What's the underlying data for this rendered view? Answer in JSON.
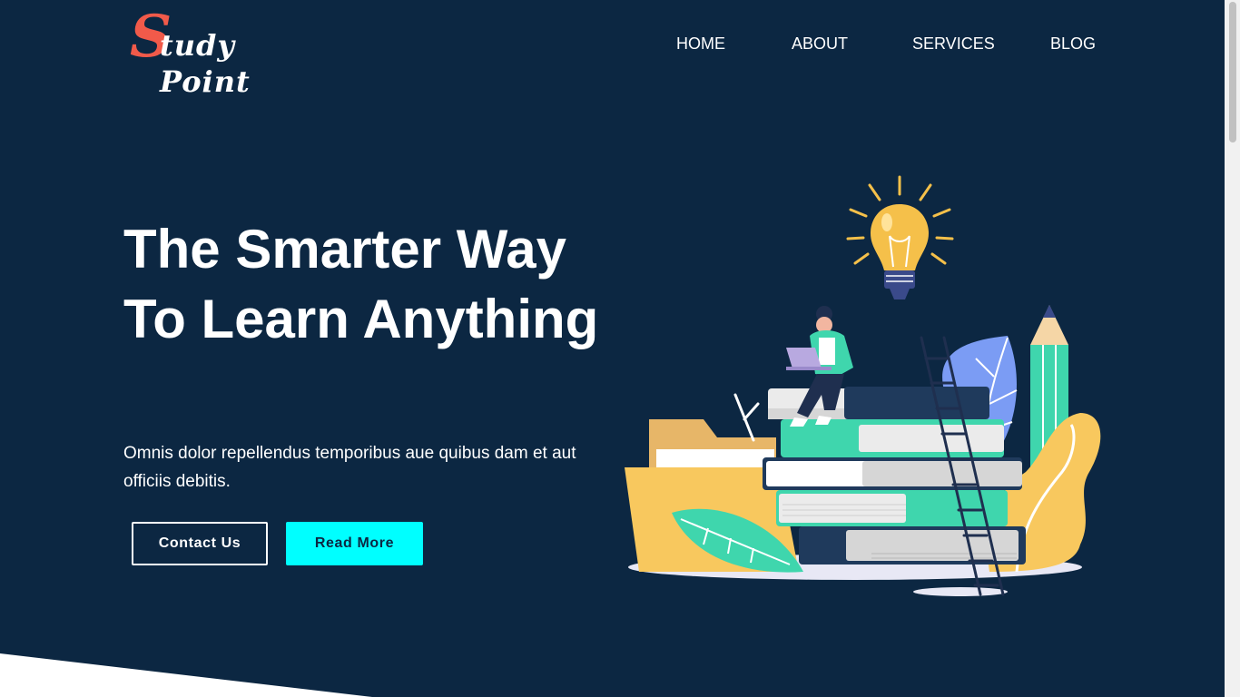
{
  "logo": {
    "initial": "S",
    "text": "tudy Point"
  },
  "nav": [
    {
      "label": "HOME"
    },
    {
      "label": "ABOUT"
    },
    {
      "label": "SERVICES"
    },
    {
      "label": "BLOG"
    }
  ],
  "hero": {
    "title": "The Smarter Way To Learn Anything",
    "text": "Omnis dolor repellendus temporibus aue quibus dam et aut officiis debitis.",
    "contact_label": "Contact Us",
    "read_label": "Read More"
  },
  "colors": {
    "background": "#0c2742",
    "accent_button": "#00ffff",
    "logo_s": "#f15a4a"
  },
  "illustration": {
    "icon": "study-illustration"
  }
}
